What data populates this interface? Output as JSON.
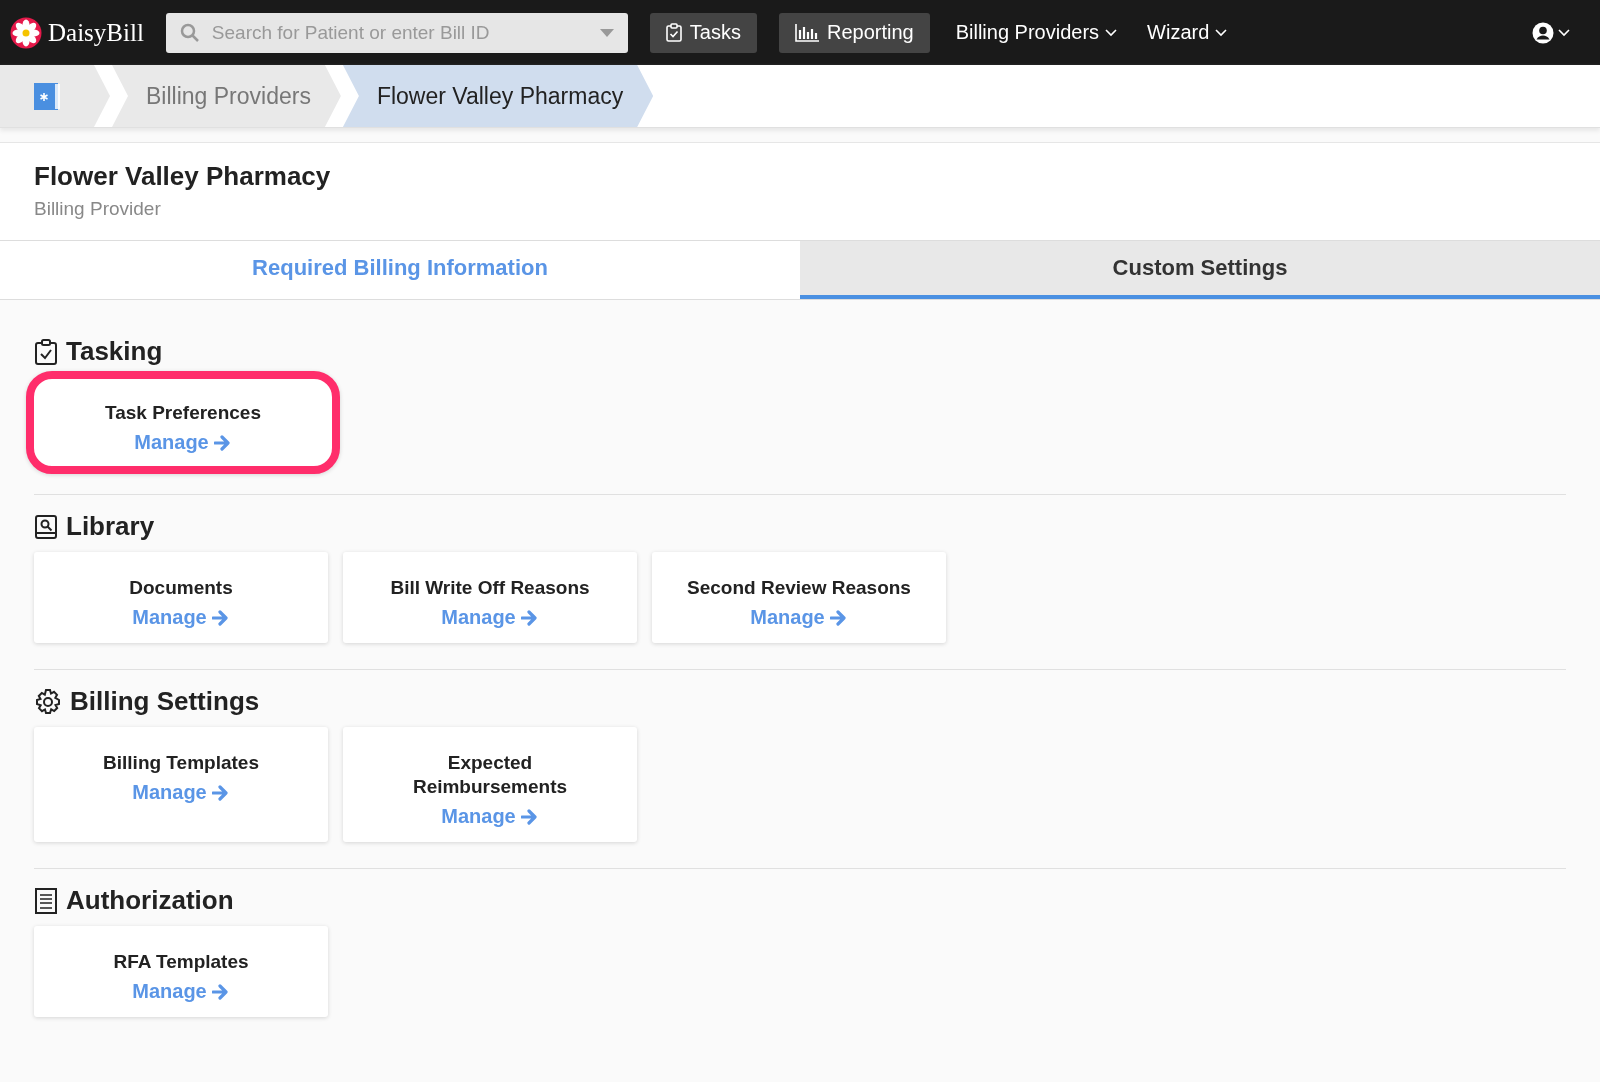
{
  "navbar": {
    "brand": "DaisyBill",
    "search": {
      "placeholder": "Search for Patient or enter Bill ID"
    },
    "buttons": [
      {
        "label": "Tasks"
      },
      {
        "label": "Reporting"
      }
    ],
    "menus": [
      {
        "label": "Billing Providers"
      },
      {
        "label": "Wizard"
      }
    ]
  },
  "breadcrumbs": [
    {
      "label": "Billing Providers",
      "selected": false
    },
    {
      "label": "Flower Valley Pharmacy",
      "selected": true
    }
  ],
  "header": {
    "title": "Flower Valley Pharmacy",
    "subtitle": "Billing Provider"
  },
  "tabs": [
    {
      "label": "Required Billing Information",
      "selected": false
    },
    {
      "label": "Custom Settings",
      "selected": true
    }
  ],
  "sections": [
    {
      "title": "Tasking",
      "cards": [
        {
          "title": "Task Preferences",
          "link": "Manage",
          "highlighted": true
        }
      ]
    },
    {
      "title": "Library",
      "cards": [
        {
          "title": "Documents",
          "link": "Manage",
          "highlighted": false
        },
        {
          "title": "Bill Write Off Reasons",
          "link": "Manage",
          "highlighted": false
        },
        {
          "title": "Second Review Reasons",
          "link": "Manage",
          "highlighted": false
        }
      ]
    },
    {
      "title": "Billing Settings",
      "cards": [
        {
          "title": "Billing Templates",
          "link": "Manage",
          "highlighted": false
        },
        {
          "title": "Expected Reimbursements",
          "link": "Manage",
          "highlighted": false
        }
      ]
    },
    {
      "title": "Authorization",
      "cards": [
        {
          "title": "RFA Templates",
          "link": "Manage",
          "highlighted": false
        }
      ]
    }
  ]
}
